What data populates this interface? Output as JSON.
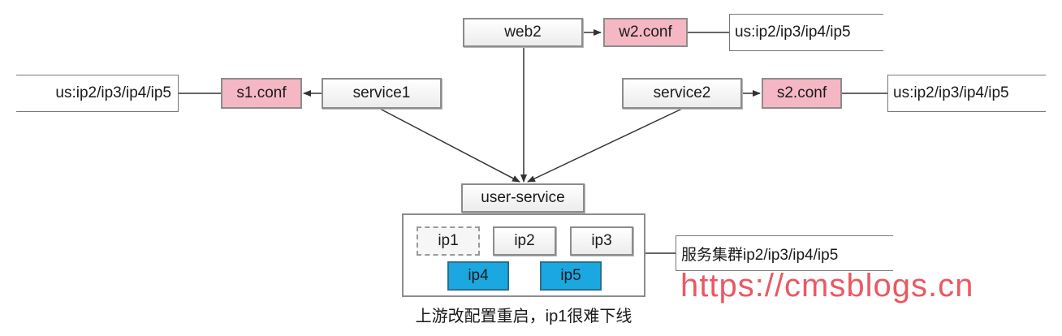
{
  "nodes": {
    "web2": "web2",
    "w2_conf": "w2.conf",
    "w2_note": "us:ip2/ip3/ip4/ip5",
    "service1": "service1",
    "s1_conf": "s1.conf",
    "s1_note": "us:ip2/ip3/ip4/ip5",
    "service2": "service2",
    "s2_conf": "s2.conf",
    "s2_note": "us:ip2/ip3/ip4/ip5",
    "user_service": "user-service",
    "ip1": "ip1",
    "ip2": "ip2",
    "ip3": "ip3",
    "ip4": "ip4",
    "ip5": "ip5",
    "cluster_note": "服务集群ip2/ip3/ip4/ip5"
  },
  "caption": "上游改配置重启，ip1很难下线",
  "watermark": "https://cmsblogs.cn",
  "colors": {
    "conf_fill": "#f5b7c3",
    "highlight_fill": "#1ba7e0",
    "box_fill": "#f0f0f0",
    "watermark": "#e63c46"
  }
}
